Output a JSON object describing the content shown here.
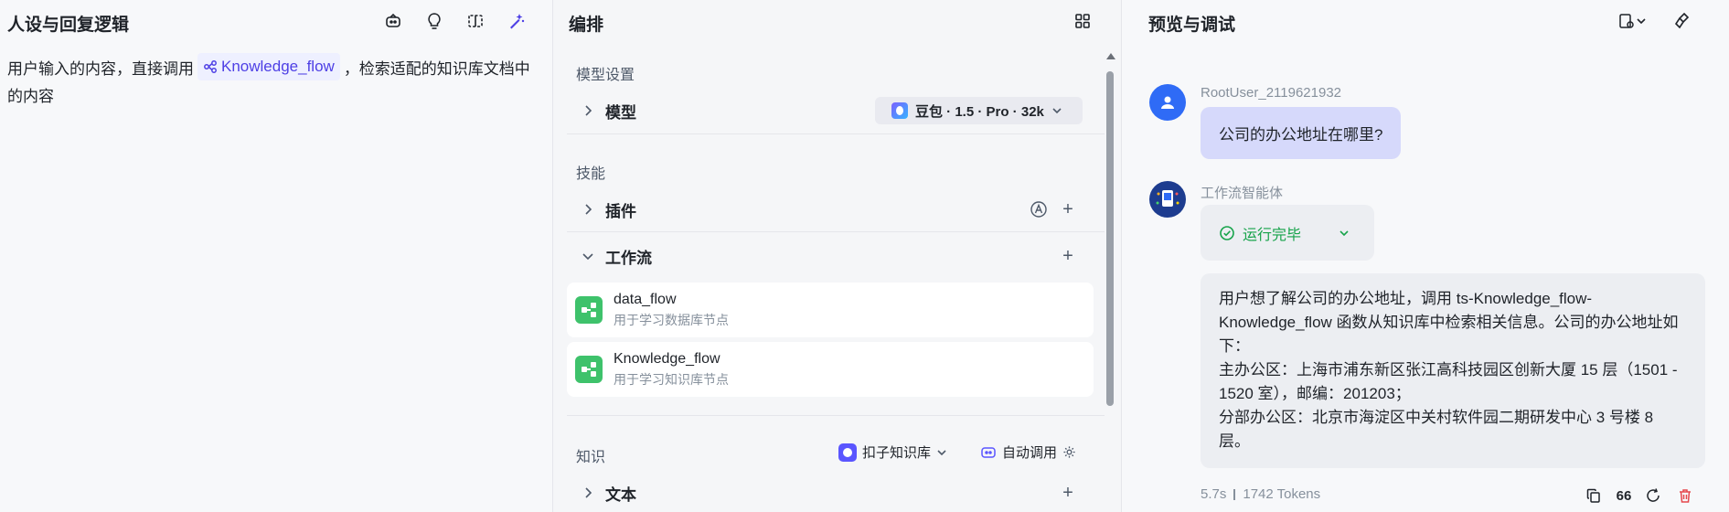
{
  "left": {
    "title": "人设与回复逻辑",
    "persona_before": "用户输入的内容，直接调用",
    "persona_ref": "Knowledge_flow",
    "persona_after": "，检索适配的知识库文档中的内容",
    "icons": [
      "robot-edit-icon",
      "bulb-icon",
      "split-view-icon",
      "magic-wand-icon"
    ]
  },
  "middle": {
    "title": "编排",
    "model_settings_label": "模型设置",
    "model_label": "模型",
    "model_value": "豆包 · 1.5 · Pro · 32k",
    "skills_label": "技能",
    "plugins_label": "插件",
    "workflow_label": "工作流",
    "workflows": [
      {
        "name": "data_flow",
        "desc": "用于学习数据库节点"
      },
      {
        "name": "Knowledge_flow",
        "desc": "用于学习知识库节点"
      }
    ],
    "knowledge_label": "知识",
    "kb_select": "扣子知识库",
    "auto_call": "自动调用",
    "text_label": "文本"
  },
  "right": {
    "title": "预览与调试",
    "user_name": "RootUser_2119621932",
    "user_message": "公司的办公地址在哪里?",
    "bot_name": "工作流智能体",
    "status": "运行完毕",
    "reply_lines": [
      "用户想了解公司的办公地址，调用 ts-Knowledge_flow-Knowledge_flow 函数从知识库中检索相关信息。公司的办公地址如下：",
      "主办公区：上海市浦东新区张江高科技园区创新大厦 15 层（1501 - 1520 室），邮编：201203；",
      "分部办公区：北京市海淀区中关村软件园二期研发中心 3 号楼 8 层。"
    ],
    "duration": "5.7s",
    "tokens": "1742 Tokens",
    "quote_count": "66"
  },
  "colors": {
    "accent": "#4e40e5",
    "success": "#16a34a",
    "user_bubble": "#d6d9fb",
    "workflow_green": "#3ec26b",
    "delete_red": "#e5484d"
  }
}
